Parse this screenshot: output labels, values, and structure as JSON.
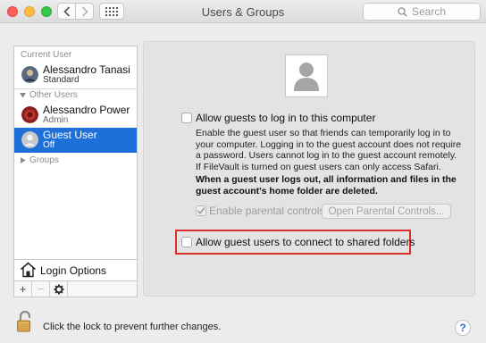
{
  "window": {
    "title": "Users & Groups"
  },
  "toolbar": {
    "search_placeholder": "Search"
  },
  "sidebar": {
    "current_user_header": "Current User",
    "current_user": {
      "name": "Alessandro Tanasi",
      "role": "Standard"
    },
    "other_users_header": "Other Users",
    "other_users": [
      {
        "name": "Alessandro Power",
        "role": "Admin"
      },
      {
        "name": "Guest User",
        "role": "Off",
        "selected": true
      }
    ],
    "groups_label": "Groups",
    "login_options_label": "Login Options",
    "tools": {
      "add": "+",
      "remove": "−"
    }
  },
  "panel": {
    "allow_login_label": "Allow guests to log in to this computer",
    "allow_login_checked": false,
    "description": "Enable the guest user so that friends can temporarily log in to your computer. Logging in to the guest account does not require a password. Users cannot log in to the guest account remotely. If FileVault is turned on guest users can only access Safari.",
    "warning": "When a guest user logs out, all information and files in the guest account's home folder are deleted.",
    "parental_controls_label": "Enable parental controls",
    "parental_controls_checked": true,
    "parental_controls_button": "Open Parental Controls...",
    "shared_folders_label": "Allow guest users to connect to shared folders",
    "shared_folders_checked": false
  },
  "footer": {
    "lock_text": "Click the lock to prevent further changes.",
    "help": "?"
  },
  "colors": {
    "selection": "#1f6fd8",
    "highlight_box": "#d9302f",
    "help_glyph": "#2e6ed6"
  }
}
